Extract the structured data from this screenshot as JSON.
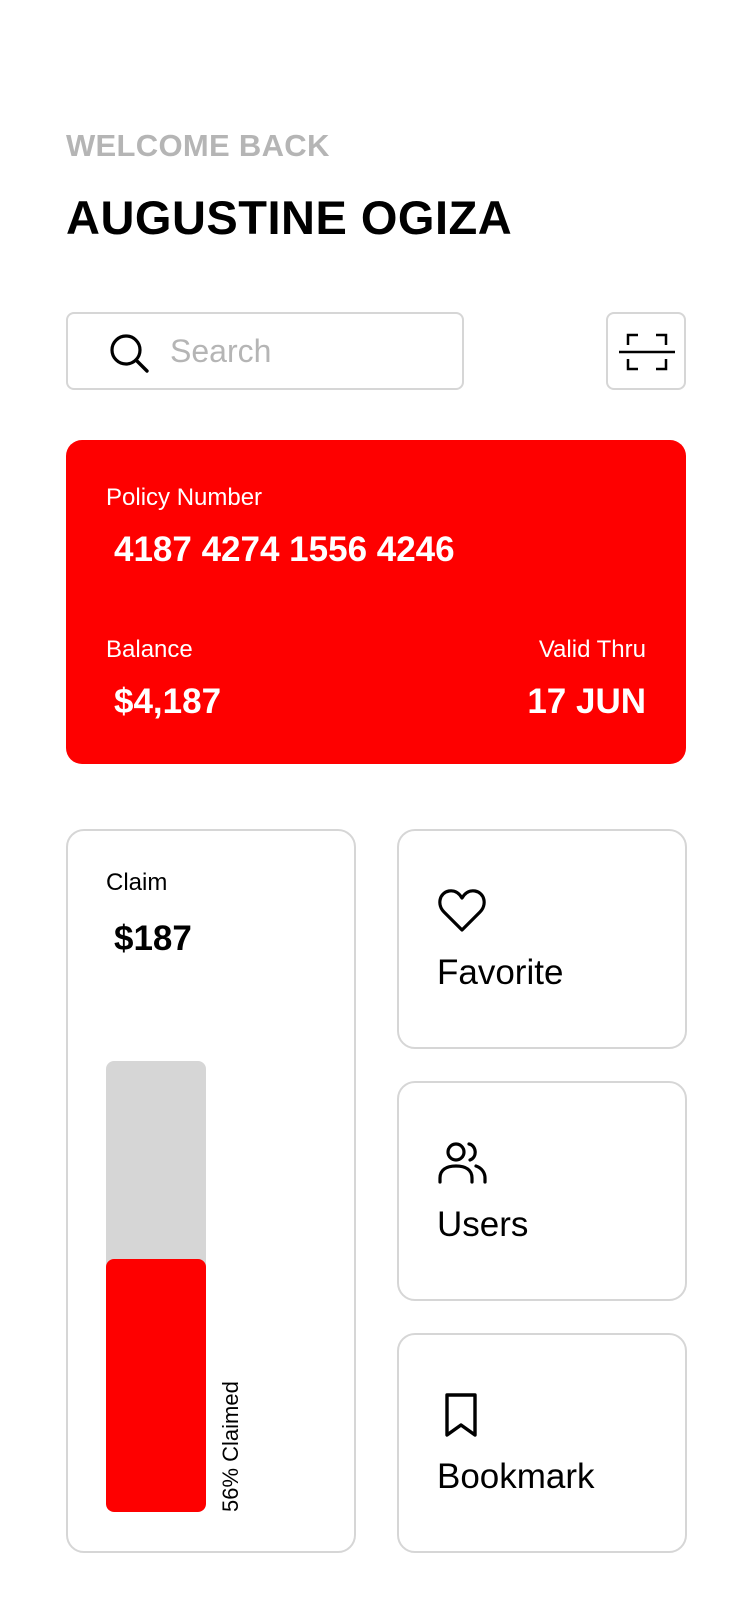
{
  "header": {
    "greeting": "WELCOME BACK",
    "user_name": "AUGUSTINE OGIZA"
  },
  "search": {
    "placeholder": "Search",
    "value": "",
    "icon": "search-icon"
  },
  "scan": {
    "icon": "scan-icon"
  },
  "policy_card": {
    "policy_label": "Policy Number",
    "policy_number": "4187 4274 1556 4246",
    "balance_label": "Balance",
    "balance_value": "$4,187",
    "valid_label": "Valid Thru",
    "valid_value": "17 JUN",
    "color": "#fe0000"
  },
  "claim_card": {
    "label": "Claim",
    "amount": "$187",
    "progress_percent": 56,
    "progress_caption": "56% Claimed",
    "fill_color": "#fe0000",
    "track_color": "#d6d6d6"
  },
  "actions": [
    {
      "label": "Favorite",
      "icon": "heart-icon"
    },
    {
      "label": "Users",
      "icon": "users-icon"
    },
    {
      "label": "Bookmark",
      "icon": "bookmark-icon"
    }
  ]
}
